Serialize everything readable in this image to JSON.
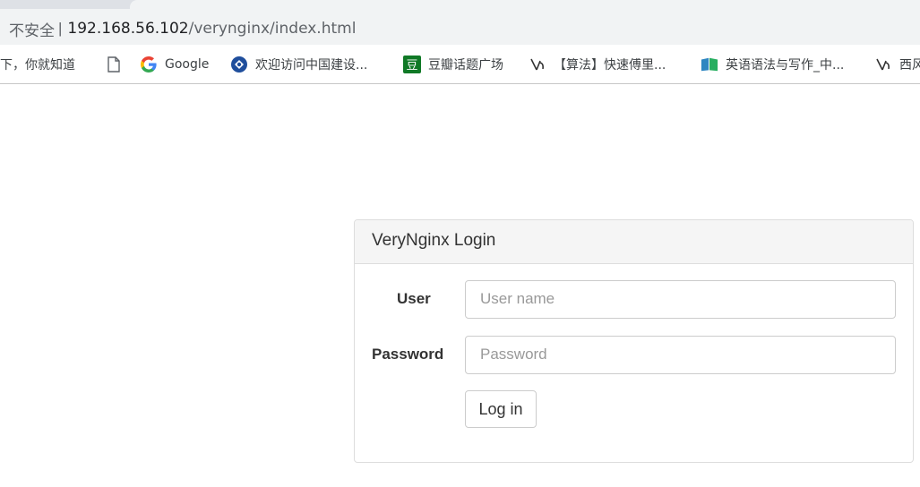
{
  "browser": {
    "security_label": "不安全",
    "separator": "|",
    "url_host": "192.168.56.102",
    "url_path": "/veryngin​x/index.html"
  },
  "bookmarks": [
    {
      "label": "一下，你就知道",
      "icon": "baidu-partial"
    },
    {
      "label": "",
      "icon": "page-icon"
    },
    {
      "label": "Google",
      "icon": "google-icon"
    },
    {
      "label": "欢迎访问中国建设...",
      "icon": "ccb-icon"
    },
    {
      "label": "豆瓣话题广场",
      "icon": "douban-icon"
    },
    {
      "label": "【算法】快速傅里...",
      "icon": "zhihu-icon"
    },
    {
      "label": "英语语法与写作_中...",
      "icon": "book-icon"
    },
    {
      "label": "西风",
      "icon": "zhihu-icon"
    }
  ],
  "login": {
    "title": "VeryNginx Login",
    "user_label": "User",
    "user_placeholder": "User name",
    "password_label": "Password",
    "password_placeholder": "Password",
    "login_button": "Log in"
  }
}
